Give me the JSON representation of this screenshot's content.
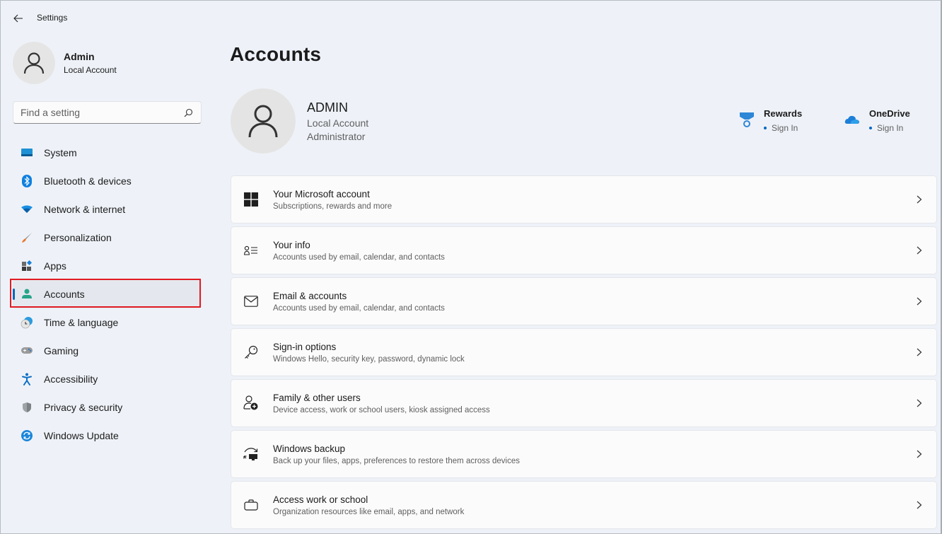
{
  "window": {
    "title": "Settings"
  },
  "profile": {
    "name": "Admin",
    "type": "Local Account"
  },
  "search": {
    "placeholder": "Find a setting"
  },
  "sidebar": {
    "items": [
      {
        "label": "System",
        "icon": "system-icon"
      },
      {
        "label": "Bluetooth & devices",
        "icon": "bluetooth-icon"
      },
      {
        "label": "Network & internet",
        "icon": "wifi-icon"
      },
      {
        "label": "Personalization",
        "icon": "brush-icon"
      },
      {
        "label": "Apps",
        "icon": "apps-icon"
      },
      {
        "label": "Accounts",
        "icon": "accounts-icon",
        "active": true
      },
      {
        "label": "Time & language",
        "icon": "clock-globe-icon"
      },
      {
        "label": "Gaming",
        "icon": "gamepad-icon"
      },
      {
        "label": "Accessibility",
        "icon": "accessibility-icon"
      },
      {
        "label": "Privacy & security",
        "icon": "shield-icon"
      },
      {
        "label": "Windows Update",
        "icon": "update-icon"
      }
    ]
  },
  "main": {
    "title": "Accounts",
    "account": {
      "name": "ADMIN",
      "type": "Local Account",
      "role": "Administrator"
    },
    "services": [
      {
        "name": "Rewards",
        "status": "Sign In",
        "icon": "rewards-medal-icon"
      },
      {
        "name": "OneDrive",
        "status": "Sign In",
        "icon": "onedrive-cloud-icon"
      }
    ],
    "cards": [
      {
        "title": "Your Microsoft account",
        "subtitle": "Subscriptions, rewards and more",
        "icon": "windows-logo-icon"
      },
      {
        "title": "Your info",
        "subtitle": "Accounts used by email, calendar, and contacts",
        "icon": "person-info-icon"
      },
      {
        "title": "Email & accounts",
        "subtitle": "Accounts used by email, calendar, and contacts",
        "icon": "mail-icon"
      },
      {
        "title": "Sign-in options",
        "subtitle": "Windows Hello, security key, password, dynamic lock",
        "icon": "key-icon"
      },
      {
        "title": "Family & other users",
        "subtitle": "Device access, work or school users, kiosk assigned access",
        "icon": "add-person-icon"
      },
      {
        "title": "Windows backup",
        "subtitle": "Back up your files, apps, preferences to restore them across devices",
        "icon": "backup-icon"
      },
      {
        "title": "Access work or school",
        "subtitle": "Organization resources like email, apps, and network",
        "icon": "briefcase-icon"
      }
    ]
  },
  "colors": {
    "accent": "#0067c0",
    "highlight_box": "#e11b22",
    "background": "#eef2f8",
    "card": "#fbfbfc"
  }
}
